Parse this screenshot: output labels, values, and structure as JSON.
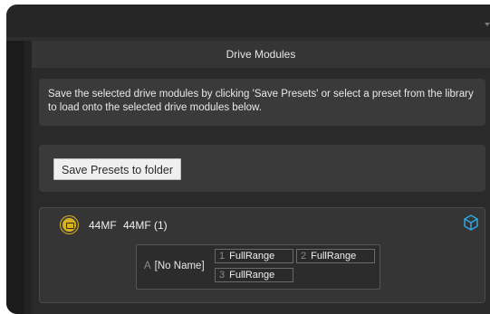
{
  "panel": {
    "title": "Drive Modules"
  },
  "info": {
    "text": "Save the selected drive modules by clicking 'Save Presets' or select a preset from the library to load onto the selected drive modules below."
  },
  "save": {
    "label": "Save Presets to folder"
  },
  "module": {
    "model": "44MF",
    "label": "44MF (1)",
    "icon": "speaker-module-icon",
    "status_icon": "cube-icon",
    "preset": {
      "slot": "A",
      "name": "[No Name]",
      "ranges": [
        {
          "num": "1",
          "value": "FullRange"
        },
        {
          "num": "2",
          "value": "FullRange"
        },
        {
          "num": "3",
          "value": "FullRange"
        }
      ]
    }
  },
  "colors": {
    "accent_yellow": "#d8b21c",
    "cube_blue": "#2ea7e0"
  }
}
